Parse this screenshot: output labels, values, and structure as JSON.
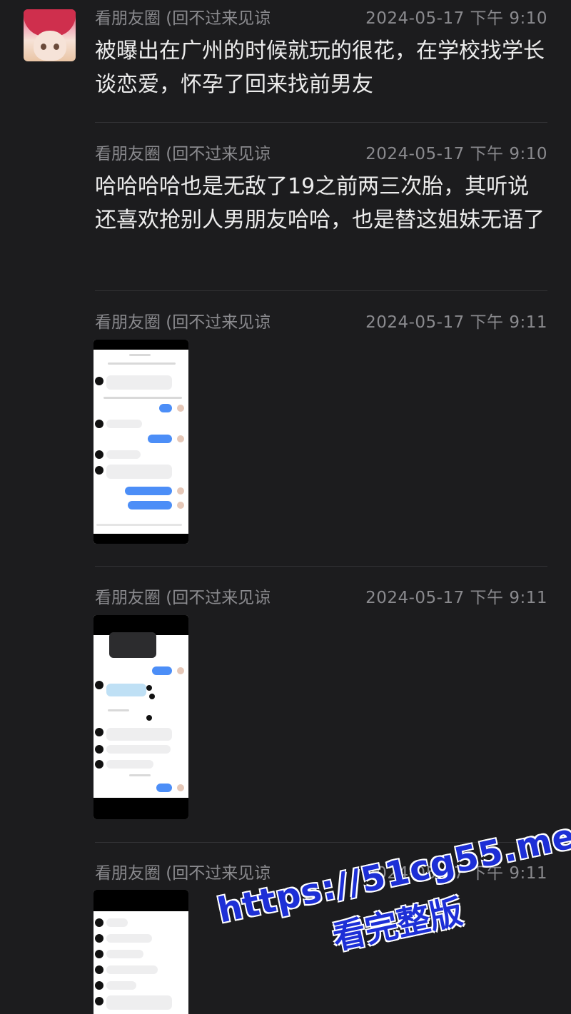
{
  "messages": [
    {
      "sender": "看朋友圈 (回不过来见谅",
      "time": "2024-05-17 下午 9:10",
      "text": "被曝出在广州的时候就玩的很花，在学校找学长谈恋爱，怀孕了回来找前男友"
    },
    {
      "sender": "看朋友圈 (回不过来见谅",
      "time": "2024-05-17 下午 9:10",
      "text": "哈哈哈哈也是无敌了19之前两三次胎，其听说还喜欢抢别人男朋友哈哈，也是替这姐妹无语了"
    },
    {
      "sender": "看朋友圈 (回不过来见谅",
      "time": "2024-05-17 下午 9:11",
      "image": "chat-screenshot-1"
    },
    {
      "sender": "看朋友圈 (回不过来见谅",
      "time": "2024-05-17 下午 9:11",
      "image": "chat-screenshot-2"
    },
    {
      "sender": "看朋友圈 (回不过来见谅",
      "time": "2024-05-17 下午 9:11",
      "image": "chat-screenshot-3"
    }
  ],
  "watermark": {
    "url": "https://51cg55.me",
    "text": "看完整版"
  },
  "colors": {
    "background": "#1c1c1e",
    "meta_text": "#8a8a8e",
    "message_text": "#ececec",
    "watermark": "#1d2fd6"
  }
}
